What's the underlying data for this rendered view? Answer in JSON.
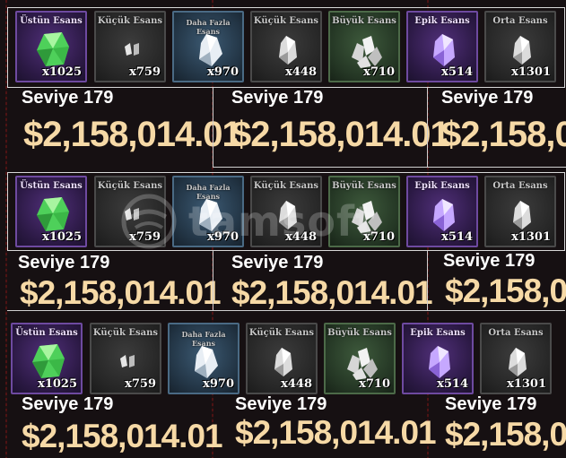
{
  "items": [
    {
      "name": "Üstün Esans",
      "count": "x1025",
      "color": "purple",
      "gem": "green-crystal-icon"
    },
    {
      "name": "Küçük Esans",
      "count": "x759",
      "color": "gray",
      "gem": "small-shard-icon"
    },
    {
      "name": "Daha Fazla Esans",
      "count": "x970",
      "color": "blue",
      "gem": "crystal-icon"
    },
    {
      "name": "Küçük Esans",
      "count": "x448",
      "color": "gray",
      "gem": "crystal-icon"
    },
    {
      "name": "Büyük Esans",
      "count": "x710",
      "color": "green",
      "gem": "crystal-cluster-icon"
    },
    {
      "name": "Epik Esans",
      "count": "x514",
      "color": "purple",
      "gem": "purple-crystal-icon"
    },
    {
      "name": "Orta Esans",
      "count": "x1301",
      "color": "gray",
      "gem": "crystal-icon"
    }
  ],
  "level_text": "Seviye 179",
  "price_text": "$2,158,014.01",
  "price_cut": "$2,158,0",
  "price_cut2": "$2,158,01",
  "watermark": {
    "text": "tamsoft"
  }
}
